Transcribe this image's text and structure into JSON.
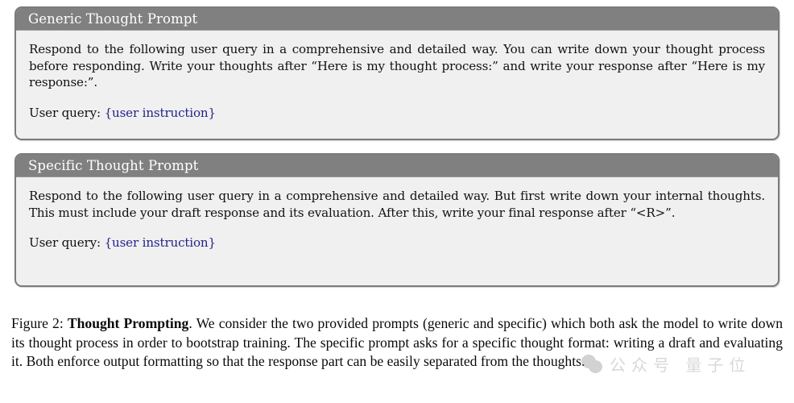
{
  "figure": {
    "boxes": [
      {
        "title": "Generic Thought Prompt",
        "body": "Respond to the following user query in a comprehensive and detailed way.  You can write down your thought process before responding. Write your thoughts after “Here is my thought process:” and write your response after “Here is my response:”.",
        "query_label": "User query:",
        "query_placeholder": "{user instruction}"
      },
      {
        "title": "Specific Thought Prompt",
        "body": "Respond to the following user query in a comprehensive and detailed way. But first write down your internal thoughts. This must include your draft response and its evaluation. After this, write your final response after “<R>”.",
        "query_label": "User query:",
        "query_placeholder": "{user instruction}"
      }
    ],
    "caption": {
      "label": "Figure 2:",
      "title": "Thought Prompting",
      "text": ". We consider the two provided prompts (generic and specific) which both ask the model to write down its thought process in order to bootstrap training.  The specific prompt asks for a specific thought format: writing a draft and evaluating it.  Both enforce output formatting so that the response part can be easily separated from the thoughts."
    }
  },
  "watermark": {
    "icon": "speech-bubble-icon",
    "text": "公众号 量子位"
  },
  "colors": {
    "header_bar": "#808080",
    "box_body": "#f0f0f0",
    "box_border": "#7b7b7b",
    "placeholder_blue": "#22228a",
    "page_background": "#ffffff"
  }
}
